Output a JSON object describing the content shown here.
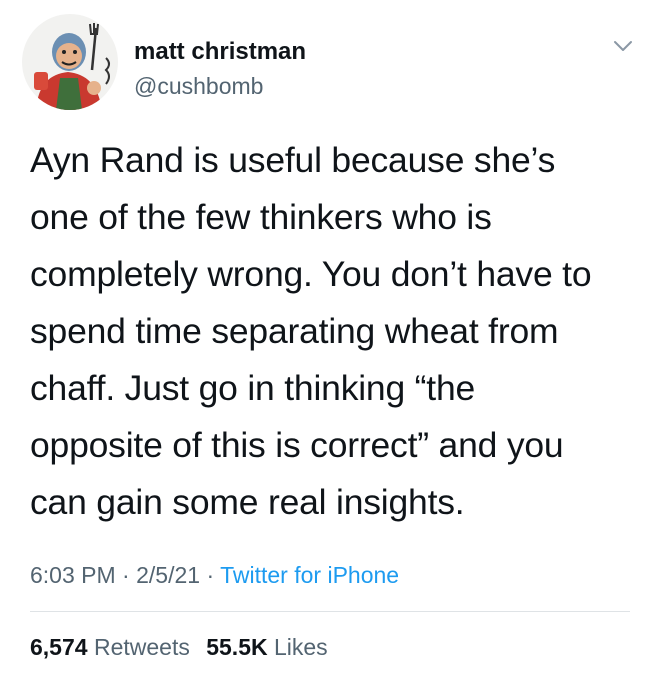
{
  "author": {
    "display_name": "matt christman",
    "handle": "@cushbomb",
    "avatar_icon": "cartoon-chef-avatar-icon"
  },
  "tweet": {
    "text_lines": [
      "Ayn Rand is useful because she’s",
      "one of the few thinkers who is",
      "completely wrong. You don’t have to",
      "spend time separating wheat from",
      "chaff. Just go in thinking “the",
      "opposite of this is correct” and you",
      "can gain some real insights."
    ],
    "time": "6:03 PM",
    "separator": "·",
    "date": "2/5/21",
    "source": "Twitter for iPhone"
  },
  "stats": {
    "retweets_count": "6,574",
    "retweets_label": "Retweets",
    "likes_count": "55.5K",
    "likes_label": "Likes"
  },
  "colors": {
    "text": "#0f1419",
    "secondary": "#536471",
    "link": "#1d9bf0"
  }
}
